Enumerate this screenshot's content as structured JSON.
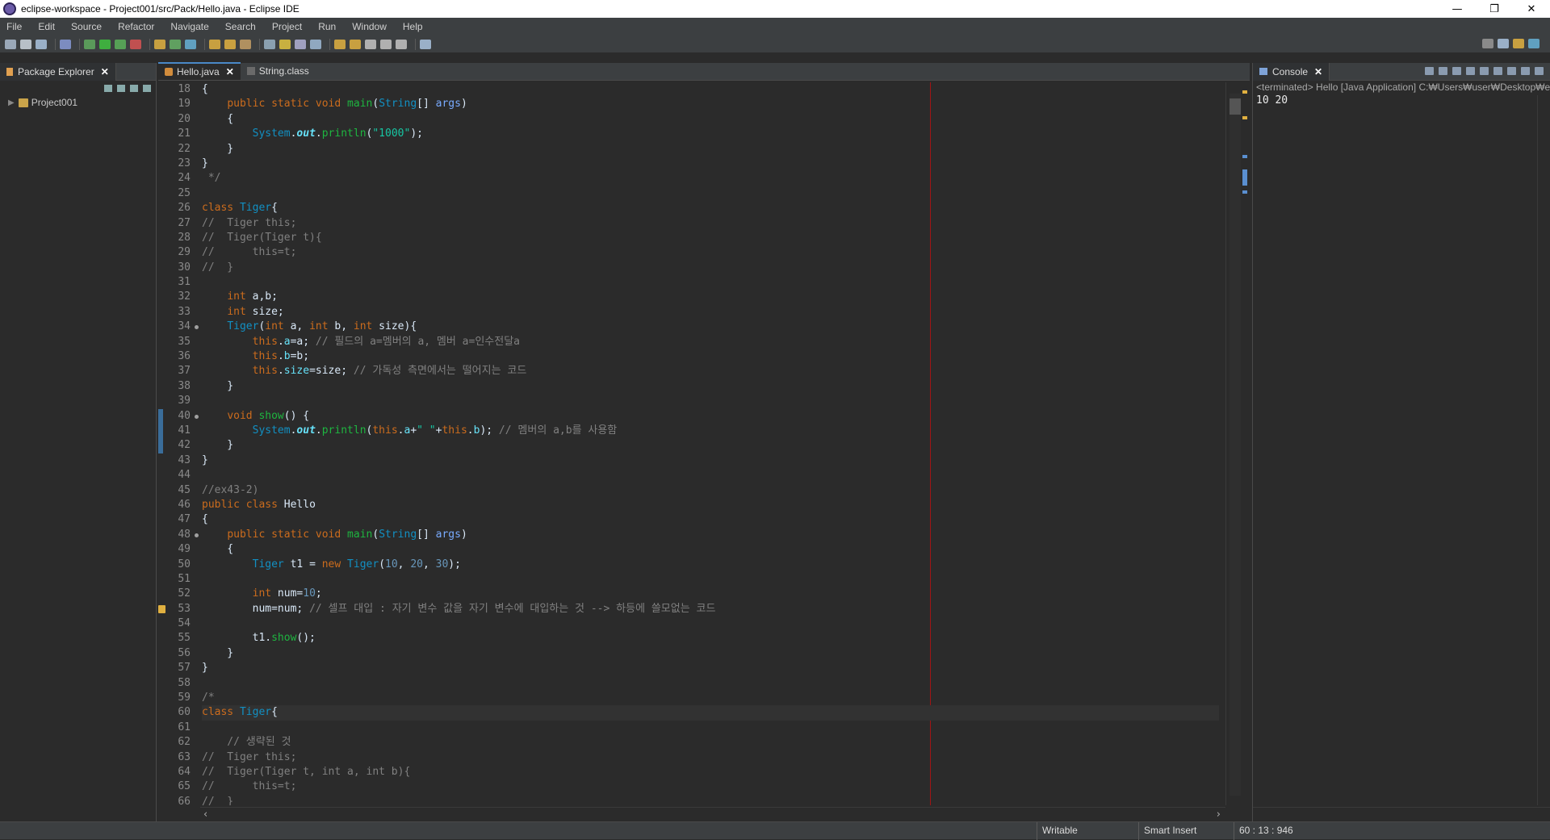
{
  "window": {
    "title": "eclipse-workspace - Project001/src/Pack/Hello.java - Eclipse IDE"
  },
  "menu": [
    "File",
    "Edit",
    "Source",
    "Refactor",
    "Navigate",
    "Search",
    "Project",
    "Run",
    "Window",
    "Help"
  ],
  "package_explorer": {
    "tab_label": "Package Explorer",
    "project": "Project001"
  },
  "editor": {
    "tabs": [
      {
        "label": "Hello.java",
        "active": true
      },
      {
        "label": "String.class",
        "active": false
      }
    ],
    "first_line_fragment": "public class Hello",
    "lines": [
      {
        "n": 18,
        "text": "{"
      },
      {
        "n": 19,
        "text": "    public static void main(String[] args)"
      },
      {
        "n": 20,
        "text": "    {"
      },
      {
        "n": 21,
        "text": "        System.out.println(\"1000\");"
      },
      {
        "n": 22,
        "text": "    }"
      },
      {
        "n": 23,
        "text": "}"
      },
      {
        "n": 24,
        "text": " */"
      },
      {
        "n": 25,
        "text": ""
      },
      {
        "n": 26,
        "text": "class Tiger{"
      },
      {
        "n": 27,
        "text": "//  Tiger this;"
      },
      {
        "n": 28,
        "text": "//  Tiger(Tiger t){"
      },
      {
        "n": 29,
        "text": "//      this=t;"
      },
      {
        "n": 30,
        "text": "//  }"
      },
      {
        "n": 31,
        "text": ""
      },
      {
        "n": 32,
        "text": "    int a,b;"
      },
      {
        "n": 33,
        "text": "    int size;"
      },
      {
        "n": 34,
        "text": "    Tiger(int a, int b, int size){"
      },
      {
        "n": 35,
        "text": "        this.a=a; // 필드의 a=멤버의 a, 멤버 a=인수전달a"
      },
      {
        "n": 36,
        "text": "        this.b=b;"
      },
      {
        "n": 37,
        "text": "        this.size=size; // 가독성 측면에서는 떨어지는 코드"
      },
      {
        "n": 38,
        "text": "    }"
      },
      {
        "n": 39,
        "text": ""
      },
      {
        "n": 40,
        "text": "    void show() {"
      },
      {
        "n": 41,
        "text": "        System.out.println(this.a+\" \"+this.b); // 멤버의 a,b를 사용함"
      },
      {
        "n": 42,
        "text": "    }"
      },
      {
        "n": 43,
        "text": "}"
      },
      {
        "n": 44,
        "text": ""
      },
      {
        "n": 45,
        "text": "//ex43-2)"
      },
      {
        "n": 46,
        "text": "public class Hello"
      },
      {
        "n": 47,
        "text": "{"
      },
      {
        "n": 48,
        "text": "    public static void main(String[] args)"
      },
      {
        "n": 49,
        "text": "    {"
      },
      {
        "n": 50,
        "text": "        Tiger t1 = new Tiger(10, 20, 30);"
      },
      {
        "n": 51,
        "text": ""
      },
      {
        "n": 52,
        "text": "        int num=10;"
      },
      {
        "n": 53,
        "text": "        num=num; // 셀프 대입 : 자기 변수 값을 자기 변수에 대입하는 것 --> 하등에 쓸모없는 코드"
      },
      {
        "n": 54,
        "text": ""
      },
      {
        "n": 55,
        "text": "        t1.show();"
      },
      {
        "n": 56,
        "text": "    }"
      },
      {
        "n": 57,
        "text": "}"
      },
      {
        "n": 58,
        "text": ""
      },
      {
        "n": 59,
        "text": "/*"
      },
      {
        "n": 60,
        "text": "class Tiger{"
      },
      {
        "n": 61,
        "text": ""
      },
      {
        "n": 62,
        "text": "    // 생략된 것"
      },
      {
        "n": 63,
        "text": "//  Tiger this;"
      },
      {
        "n": 64,
        "text": "//  Tiger(Tiger t, int a, int b){"
      },
      {
        "n": 65,
        "text": "//      this=t;"
      },
      {
        "n": 66,
        "text": "//  }"
      }
    ]
  },
  "console": {
    "tab_label": "Console",
    "description": "<terminated> Hello [Java Application] C:₩Users₩user₩Desktop₩ec",
    "output": "10 20"
  },
  "status": {
    "writable": "Writable",
    "insert_mode": "Smart Insert",
    "position": "60 : 13 : 946"
  },
  "colors": {
    "keyword": "#cc6c1d",
    "type": "#1290c3",
    "comment": "#808080",
    "field": "#66e1f8",
    "method": "#1eb540",
    "string": "#17c6a3",
    "number": "#6897bb",
    "print_margin": "#a11414"
  }
}
